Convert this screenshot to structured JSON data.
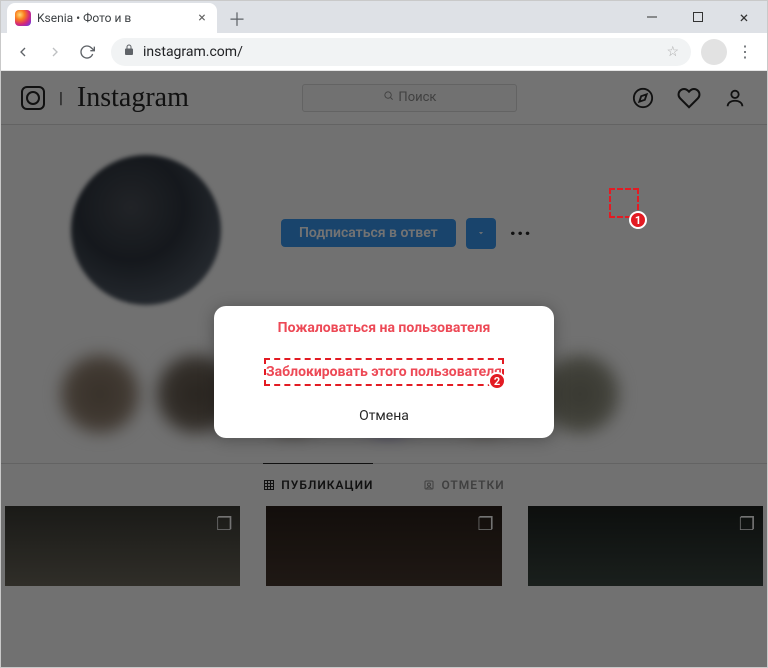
{
  "browser": {
    "tab_title": "Ksenia             • Фото и в",
    "url": "instagram.com/"
  },
  "header": {
    "wordmark": "Instagram",
    "search_placeholder": "Поиск"
  },
  "profile": {
    "follow_back_label": "Подписаться в ответ"
  },
  "modal": {
    "report_label": "Пожаловаться на пользователя",
    "block_label": "Заблокировать этого пользователя",
    "cancel_label": "Отмена"
  },
  "tabs": {
    "posts_label": "ПУБЛИКАЦИИ",
    "tagged_label": "ОТМЕТКИ"
  },
  "annotations": {
    "badge1": "1",
    "badge2": "2"
  }
}
